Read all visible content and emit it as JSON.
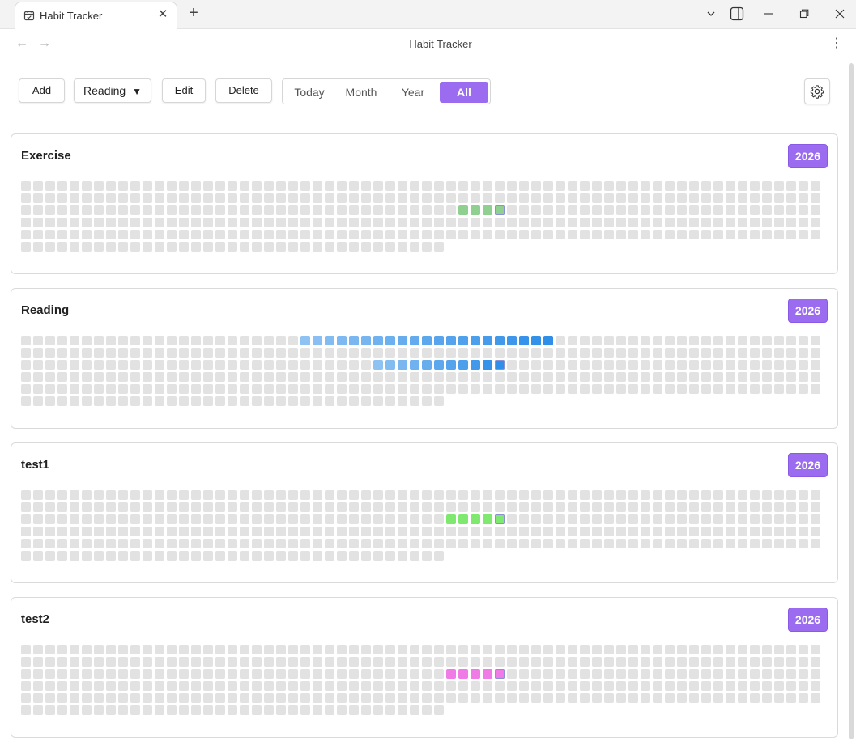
{
  "window": {
    "tab_title": "Habit Tracker",
    "tab_icon": "calendar-icon",
    "new_tab_symbol": "+",
    "tab_close_symbol": "✕"
  },
  "nav": {
    "title": "Habit Tracker",
    "back_symbol": "←",
    "forward_symbol": "→",
    "more_symbol": "⋮"
  },
  "toolbar": {
    "add_label": "Add",
    "select_value": "Reading",
    "edit_label": "Edit",
    "delete_label": "Delete",
    "ranges": [
      "Today",
      "Month",
      "Year",
      "All"
    ],
    "active_range": "All"
  },
  "colors": {
    "accent": "#9b6cf0",
    "empty_cell": "#e2e2e2"
  },
  "habits": [
    {
      "name": "Exercise",
      "year": "2026",
      "color": "#8fcf8f",
      "filled_days": 4,
      "completed_days": [
        {
          "row": 2,
          "cols": [
            36,
            37,
            38,
            39
          ]
        }
      ],
      "today": {
        "row": 2,
        "col": 39
      }
    },
    {
      "name": "Reading",
      "year": "2026",
      "color": "#2f8fe8",
      "filled_days": 21,
      "completed_days": [
        {
          "row": 0,
          "cols": [
            23,
            24,
            25,
            26,
            27,
            28,
            29,
            30,
            31,
            32,
            33,
            34,
            35,
            36,
            37,
            38,
            39,
            40,
            41,
            42,
            43
          ]
        },
        {
          "row": 2,
          "cols": [
            29,
            30,
            31,
            32,
            33,
            34,
            35,
            36,
            37,
            38,
            39
          ]
        }
      ],
      "today": {
        "row": 2,
        "col": 39
      }
    },
    {
      "name": "test1",
      "year": "2026",
      "color": "#7ee86f",
      "filled_days": 5,
      "completed_days": [
        {
          "row": 2,
          "cols": [
            35,
            36,
            37,
            38,
            39
          ]
        }
      ],
      "today": {
        "row": 2,
        "col": 39
      }
    },
    {
      "name": "test2",
      "year": "2026",
      "color": "#f07be6",
      "filled_days": 5,
      "completed_days": [
        {
          "row": 2,
          "cols": [
            35,
            36,
            37,
            38,
            39
          ]
        }
      ],
      "today": {
        "row": 2,
        "col": 39
      }
    }
  ]
}
